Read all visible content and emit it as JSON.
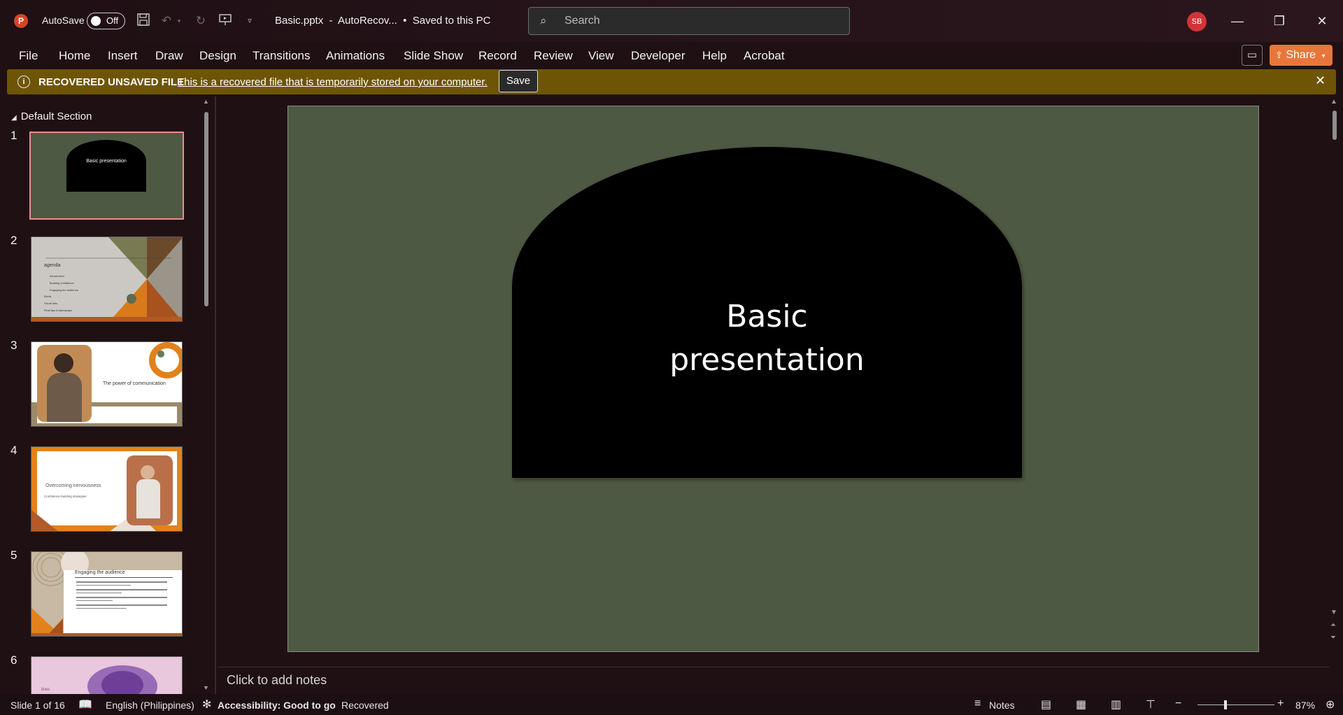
{
  "app": {
    "autosave_label": "AutoSave",
    "autosave_state": "Off",
    "doc_title": "Basic.pptx  -  AutoRecov...  •  Saved to this PC",
    "search_placeholder": "Search",
    "user_initials": "SB",
    "app_logo": "P"
  },
  "ribbon": {
    "tabs": [
      "File",
      "Home",
      "Insert",
      "Draw",
      "Design",
      "Transitions",
      "Animations",
      "Slide Show",
      "Record",
      "Review",
      "View",
      "Developer",
      "Help",
      "Acrobat"
    ],
    "share_label": "Share"
  },
  "message_bar": {
    "title": "RECOVERED UNSAVED FILE",
    "text": "This is a recovered file that is temporarily stored on your computer.",
    "save_label": "Save"
  },
  "thumbnails": {
    "section_name": "Default Section",
    "slides": [
      {
        "num": "1",
        "text": "Basic presentation"
      },
      {
        "num": "2",
        "text": "agenda",
        "bullets": [
          "Introduction",
          "Building confidence",
          "Engaging the audience"
        ],
        "extra": [
          "Break",
          "Visual aids",
          "Final tips & takeaways"
        ]
      },
      {
        "num": "3",
        "text": "The power of communication"
      },
      {
        "num": "4",
        "text": "Overcoming nervousness",
        "subtext": "Confidence-building strategies"
      },
      {
        "num": "5",
        "text": "Engaging the audience"
      },
      {
        "num": "6",
        "text": "lines"
      }
    ]
  },
  "slide": {
    "title_line1": "Basic",
    "title_line2": "presentation"
  },
  "notes": {
    "placeholder": "Click to add notes"
  },
  "status": {
    "slide_indicator": "Slide 1 of 16",
    "language": "English (Philippines)",
    "accessibility": "Accessibility: Good to go",
    "recovered": "Recovered",
    "notes_label": "Notes",
    "zoom": "87%"
  },
  "colors": {
    "slide_background": "#4d5942",
    "arch_fill": "#000000",
    "message_bar": "#6e5506",
    "share_button": "#e8763b",
    "selected_thumb_border": "#f08c8c"
  }
}
